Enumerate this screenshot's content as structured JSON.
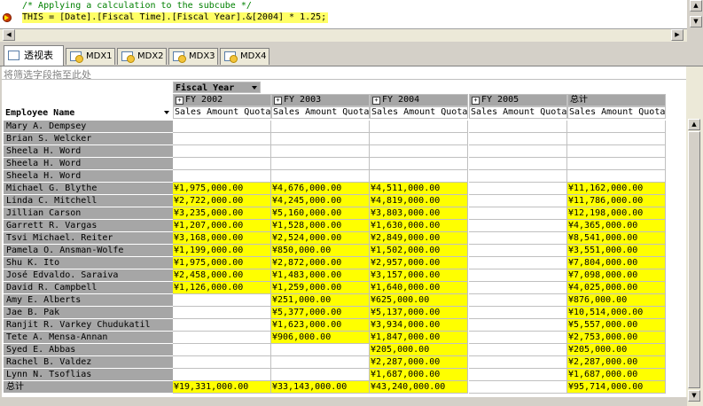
{
  "editor": {
    "line1": "/* Applying a calculation to the subcube */",
    "line2": "THIS = [Date].[Fiscal Time].[Fiscal Year].&[2004] * 1.25;"
  },
  "tabs": [
    {
      "label": "透视表",
      "active": true
    },
    {
      "label": "MDX1"
    },
    {
      "label": "MDX2"
    },
    {
      "label": "MDX3"
    },
    {
      "label": "MDX4"
    }
  ],
  "pivot": {
    "filter_placeholder": "将筛选字段拖至此处",
    "column_field": "Fiscal Year",
    "row_field": "Employee Name",
    "columns": [
      "FY 2002",
      "FY 2003",
      "FY 2004",
      "FY 2005",
      "总计"
    ],
    "measure": "Sales Amount Quota",
    "rows": [
      {
        "name": "Mary A. Dempsey",
        "values": [
          "",
          "",
          "",
          "",
          ""
        ]
      },
      {
        "name": "Brian S. Welcker",
        "values": [
          "",
          "",
          "",
          "",
          ""
        ]
      },
      {
        "name": "Sheela H. Word",
        "values": [
          "",
          "",
          "",
          "",
          ""
        ]
      },
      {
        "name": "Sheela H. Word",
        "values": [
          "",
          "",
          "",
          "",
          ""
        ]
      },
      {
        "name": "Sheela H. Word",
        "values": [
          "",
          "",
          "",
          "",
          ""
        ]
      },
      {
        "name": "Michael G. Blythe",
        "values": [
          "¥1,975,000.00",
          "¥4,676,000.00",
          "¥4,511,000.00",
          "",
          "¥11,162,000.00"
        ]
      },
      {
        "name": "Linda C. Mitchell",
        "values": [
          "¥2,722,000.00",
          "¥4,245,000.00",
          "¥4,819,000.00",
          "",
          "¥11,786,000.00"
        ]
      },
      {
        "name": "Jillian Carson",
        "values": [
          "¥3,235,000.00",
          "¥5,160,000.00",
          "¥3,803,000.00",
          "",
          "¥12,198,000.00"
        ]
      },
      {
        "name": "Garrett R. Vargas",
        "values": [
          "¥1,207,000.00",
          "¥1,528,000.00",
          "¥1,630,000.00",
          "",
          "¥4,365,000.00"
        ]
      },
      {
        "name": "Tsvi Michael. Reiter",
        "values": [
          "¥3,168,000.00",
          "¥2,524,000.00",
          "¥2,849,000.00",
          "",
          "¥8,541,000.00"
        ]
      },
      {
        "name": "Pamela O. Ansman-Wolfe",
        "values": [
          "¥1,199,000.00",
          "¥850,000.00",
          "¥1,502,000.00",
          "",
          "¥3,551,000.00"
        ]
      },
      {
        "name": "Shu K. Ito",
        "values": [
          "¥1,975,000.00",
          "¥2,872,000.00",
          "¥2,957,000.00",
          "",
          "¥7,804,000.00"
        ]
      },
      {
        "name": "José Edvaldo. Saraiva",
        "values": [
          "¥2,458,000.00",
          "¥1,483,000.00",
          "¥3,157,000.00",
          "",
          "¥7,098,000.00"
        ]
      },
      {
        "name": "David R. Campbell",
        "values": [
          "¥1,126,000.00",
          "¥1,259,000.00",
          "¥1,640,000.00",
          "",
          "¥4,025,000.00"
        ]
      },
      {
        "name": "Amy E. Alberts",
        "values": [
          "",
          "¥251,000.00",
          "¥625,000.00",
          "",
          "¥876,000.00"
        ]
      },
      {
        "name": "Jae B. Pak",
        "values": [
          "",
          "¥5,377,000.00",
          "¥5,137,000.00",
          "",
          "¥10,514,000.00"
        ]
      },
      {
        "name": "Ranjit R. Varkey Chudukatil",
        "values": [
          "",
          "¥1,623,000.00",
          "¥3,934,000.00",
          "",
          "¥5,557,000.00"
        ]
      },
      {
        "name": "Tete A. Mensa-Annan",
        "values": [
          "",
          "¥906,000.00",
          "¥1,847,000.00",
          "",
          "¥2,753,000.00"
        ]
      },
      {
        "name": "Syed E. Abbas",
        "values": [
          "",
          "",
          "¥205,000.00",
          "",
          "¥205,000.00"
        ]
      },
      {
        "name": "Rachel B. Valdez",
        "values": [
          "",
          "",
          "¥2,287,000.00",
          "",
          "¥2,287,000.00"
        ]
      },
      {
        "name": "Lynn N. Tsoflias",
        "values": [
          "",
          "",
          "¥1,687,000.00",
          "",
          "¥1,687,000.00"
        ]
      },
      {
        "name": "总计",
        "values": [
          "¥19,331,000.00",
          "¥33,143,000.00",
          "¥43,240,000.00",
          "",
          "¥95,714,000.00"
        ]
      }
    ]
  },
  "colors": {
    "highlight": "#ffff00",
    "header_gray": "#a6a6a6"
  },
  "icons": {
    "breakpoint": "breakpoint-arrow-icon",
    "pivot_tab": "pivot-table-icon",
    "mdx_tab": "mdx-query-icon"
  }
}
